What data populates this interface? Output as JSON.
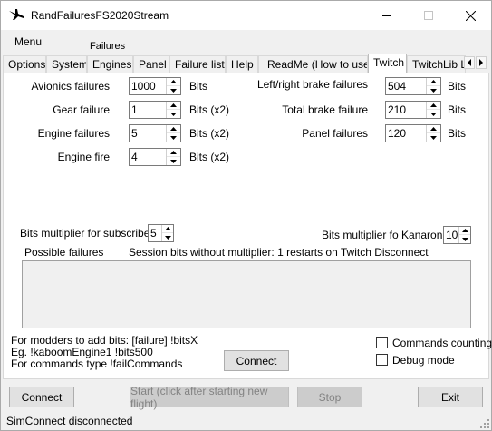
{
  "window": {
    "title": "RandFailuresFS2020Stream"
  },
  "menu": {
    "main": "Menu",
    "group_label": "Failures"
  },
  "tabs": [
    "Options",
    "System",
    "Engines",
    "Panel",
    "Failure list",
    "Help",
    "ReadMe (How to use)",
    "Twitch",
    "TwitchLib L"
  ],
  "active_tab": "Twitch",
  "twitch": {
    "avionics": {
      "label": "Avionics failures",
      "value": "1000",
      "unit": "Bits"
    },
    "gear": {
      "label": "Gear failure",
      "value": "1",
      "unit": "Bits (x2)"
    },
    "engine": {
      "label": "Engine failures",
      "value": "5",
      "unit": "Bits (x2)"
    },
    "fire": {
      "label": "Engine fire",
      "value": "4",
      "unit": "Bits (x2)"
    },
    "lr_brake": {
      "label": "Left/right brake failures",
      "value": "504",
      "unit": "Bits"
    },
    "total_brake": {
      "label": "Total brake failure",
      "value": "210",
      "unit": "Bits"
    },
    "panel": {
      "label": "Panel failures",
      "value": "120",
      "unit": "Bits"
    },
    "sub_mult": {
      "label": "Bits multiplier for subscribers",
      "value": "5"
    },
    "kanaron_mult": {
      "label": "Bits multiplier fo Kanaron ;)",
      "value": "10"
    },
    "possible_label": "Possible failures",
    "session_text": "Session bits without multiplier: 1 restarts on Twitch Disconnect",
    "mod_line1": "For modders to add bits: [failure] !bitsX",
    "mod_line2": "Eg. !kaboomEngine1 !bits500",
    "mod_line3": "For commands type !failCommands",
    "connect_label": "Connect",
    "commands_counting": "Commands counting",
    "debug_mode": "Debug mode"
  },
  "bottom": {
    "connect": "Connect",
    "start": "Start (click after starting new flight)",
    "stop": "Stop",
    "exit": "Exit"
  },
  "status": "SimConnect disconnected"
}
